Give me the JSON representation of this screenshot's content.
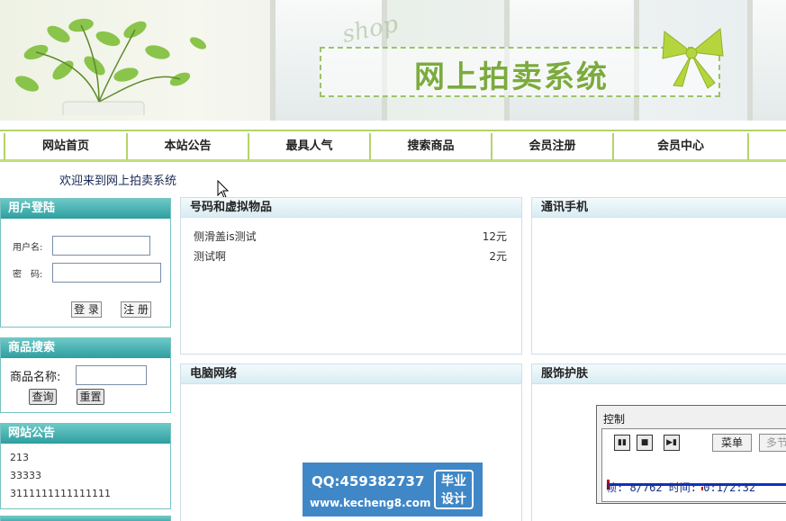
{
  "banner": {
    "title": "网上拍卖系统",
    "script_text": "shop"
  },
  "nav": [
    {
      "label": "网站首页"
    },
    {
      "label": "本站公告"
    },
    {
      "label": "最具人气"
    },
    {
      "label": "搜索商品"
    },
    {
      "label": "会员注册"
    },
    {
      "label": "会员中心"
    }
  ],
  "welcome": "欢迎来到网上拍卖系统",
  "login": {
    "title": "用户登陆",
    "username_label": "用户名:",
    "password_label": "密　码:",
    "login_button": "登 录",
    "register_button": "注 册",
    "username_value": "",
    "password_value": ""
  },
  "search": {
    "title": "商品搜索",
    "name_label": "商品名称:",
    "name_value": "",
    "query_button": "查询",
    "reset_button": "重置"
  },
  "notice": {
    "title": "网站公告",
    "items": [
      "213",
      "33333",
      "3111111111111111"
    ]
  },
  "categories": {
    "virtual": {
      "title": "号码和虚拟物品",
      "products": [
        {
          "name": "侧滑盖is测试",
          "price": "12元"
        },
        {
          "name": "测试啊",
          "price": "2元"
        }
      ]
    },
    "phone": {
      "title": "通讯手机"
    },
    "computer": {
      "title": "电脑网络"
    },
    "clothing": {
      "title": "服饰护肤"
    }
  },
  "watermark": {
    "qq": "QQ:459382737",
    "url": "www.kecheng8.com",
    "badge_line1": "毕业",
    "badge_line2": "设计"
  },
  "control": {
    "title": "控制",
    "menu_button": "菜单",
    "more_button": "多节",
    "status": "帧: 8/762 时间: 0:1/2:32"
  },
  "colors": {
    "accent_green": "#b5d36b",
    "teal_header": "#2e9ea0",
    "watermark_blue": "#3f87c7"
  }
}
